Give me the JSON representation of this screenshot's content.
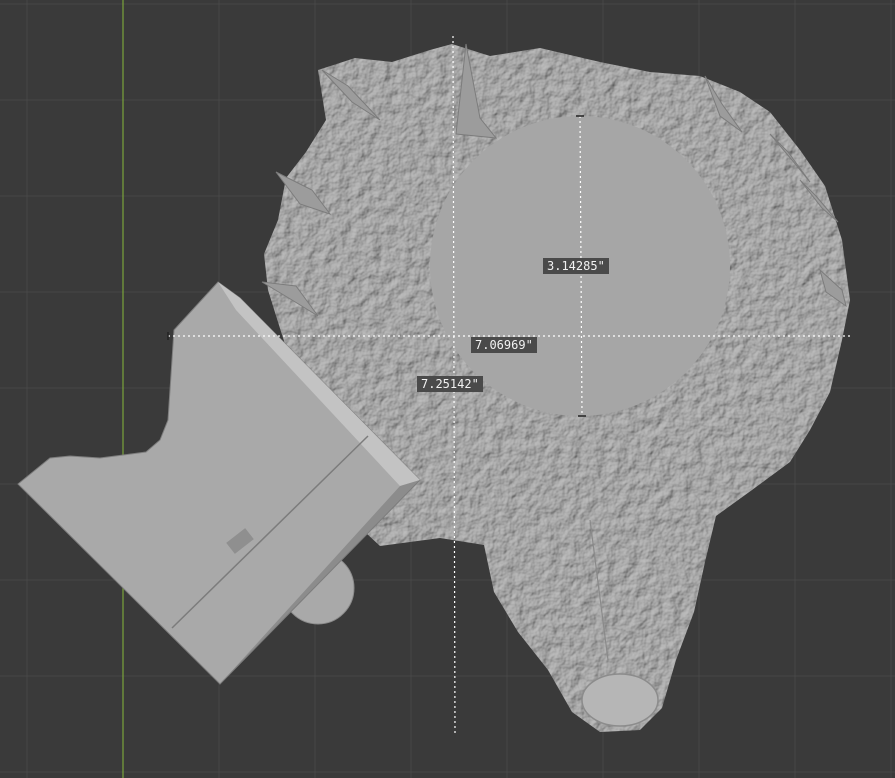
{
  "viewport": {
    "background_color": "#3a3a3a",
    "grid_color": "#474747",
    "y_axis_color": "#7aa33a",
    "mesh_color": "#a9a9a9",
    "mesh_shadow_color": "#7c7c7c",
    "mesh_highlight_color": "#c4c4c4",
    "measure_line_color": "#ffffff"
  },
  "objects": {
    "dragon_head": "sculpted-mesh",
    "stand_base": "box-mesh",
    "cylinder": "disc-mesh"
  },
  "measurements": {
    "height": "3.14285\"",
    "width": "7.06969\"",
    "depth": "7.25142\""
  }
}
